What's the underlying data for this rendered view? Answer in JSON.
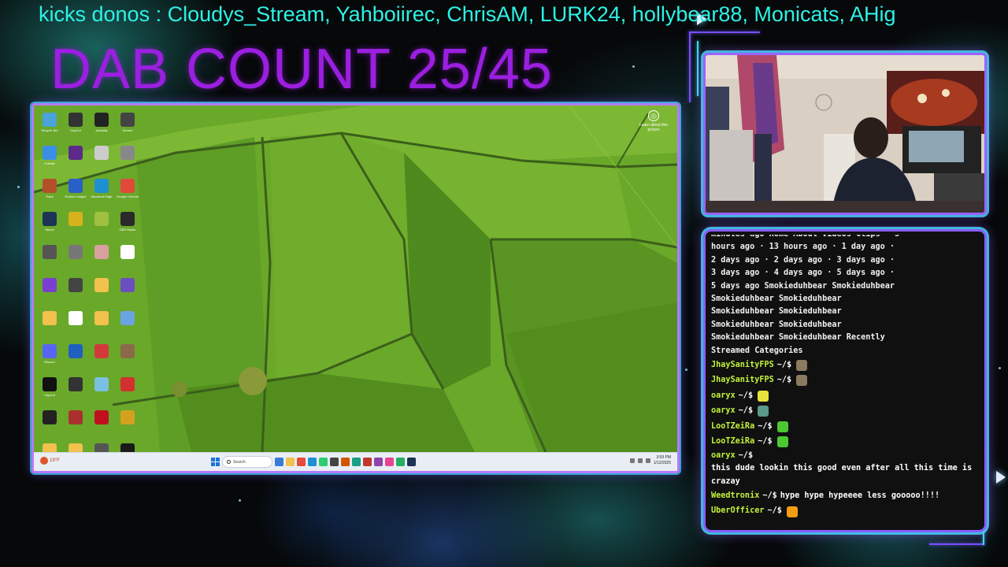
{
  "overlay": {
    "ticker": "kicks donos : Cloudys_Stream, Yahboiirec, ChrisAM, LURK24, hollybear88, Monicats, AHig",
    "dab_count": "DAB COUNT 25/45"
  },
  "desktop": {
    "icons": [
      {
        "label": "Recycle Bin",
        "icon": "recycle-bin-icon",
        "color": "#4aa3d9"
      },
      {
        "label": "CapCut",
        "icon": "obs-icon",
        "color": "#333333"
      },
      {
        "label": "Audacity",
        "icon": "app-icon",
        "color": "#222222"
      },
      {
        "label": "Drivers",
        "icon": "app-icon",
        "color": "#444444"
      },
      {
        "label": "Fortnite",
        "icon": "fortnite-icon",
        "color": "#3a8ee6"
      },
      {
        "label": "",
        "icon": "game-icon",
        "color": "#5b2a8a"
      },
      {
        "label": "",
        "icon": "app-icon",
        "color": "#cccccc"
      },
      {
        "label": "",
        "icon": "app-icon",
        "color": "#888888"
      },
      {
        "label": "Paint",
        "icon": "paint-icon",
        "color": "#b34f2a"
      },
      {
        "label": "Rocket League",
        "icon": "rocket-league-icon",
        "color": "#2a5fc9"
      },
      {
        "label": "Microsoft Edge",
        "icon": "edge-icon",
        "color": "#1e8fd1"
      },
      {
        "label": "Google Chrome",
        "icon": "chrome-icon",
        "color": "#e14a3b"
      },
      {
        "label": "Steam",
        "icon": "steam-icon",
        "color": "#1b3355"
      },
      {
        "label": "",
        "icon": "app-icon",
        "color": "#d8b21c"
      },
      {
        "label": "",
        "icon": "app-icon",
        "color": "#a0c040"
      },
      {
        "label": "OBS Studio",
        "icon": "obs-icon",
        "color": "#2a2a2a"
      },
      {
        "label": "",
        "icon": "obs-icon",
        "color": "#555555"
      },
      {
        "label": "",
        "icon": "app-icon",
        "color": "#777777"
      },
      {
        "label": "",
        "icon": "app-icon",
        "color": "#d9a0a0"
      },
      {
        "label": "",
        "icon": "app-icon",
        "color": "#ffffff"
      },
      {
        "label": "",
        "icon": "app-icon",
        "color": "#7a3fd0"
      },
      {
        "label": "",
        "icon": "obs-icon",
        "color": "#444444"
      },
      {
        "label": "",
        "icon": "folder-icon",
        "color": "#f2c14e"
      },
      {
        "label": "",
        "icon": "app-icon",
        "color": "#6b4fbf"
      },
      {
        "label": "",
        "icon": "folder-icon",
        "color": "#f2c14e"
      },
      {
        "label": "",
        "icon": "document-icon",
        "color": "#ffffff"
      },
      {
        "label": "",
        "icon": "folder-icon",
        "color": "#f2c14e"
      },
      {
        "label": "",
        "icon": "image-icon",
        "color": "#6aa4e0"
      },
      {
        "label": "Discord",
        "icon": "discord-icon",
        "color": "#5865f2"
      },
      {
        "label": "",
        "icon": "app-icon",
        "color": "#2060c0"
      },
      {
        "label": "",
        "icon": "map-pin-icon",
        "color": "#d23a3a"
      },
      {
        "label": "",
        "icon": "app-icon",
        "color": "#8a6a4a"
      },
      {
        "label": "CapCut",
        "icon": "capcut-icon",
        "color": "#111111"
      },
      {
        "label": "",
        "icon": "obs-icon",
        "color": "#333333"
      },
      {
        "label": "",
        "icon": "app-icon",
        "color": "#7ac0e0"
      },
      {
        "label": "",
        "icon": "app-icon",
        "color": "#d33030"
      },
      {
        "label": "",
        "icon": "obs-icon",
        "color": "#222222"
      },
      {
        "label": "",
        "icon": "app-icon",
        "color": "#aa3030"
      },
      {
        "label": "",
        "icon": "app-icon",
        "color": "#c01020"
      },
      {
        "label": "",
        "icon": "app-icon",
        "color": "#d4a020"
      },
      {
        "label": "",
        "icon": "folder-icon",
        "color": "#f2c14e"
      },
      {
        "label": "",
        "icon": "folder-icon",
        "color": "#f2c14e"
      },
      {
        "label": "",
        "icon": "app-icon",
        "color": "#555555"
      },
      {
        "label": "",
        "icon": "epic-games-icon",
        "color": "#1a1a1a"
      }
    ],
    "learn_label": "Learn about this picture",
    "taskbar": {
      "weather_text": "19°F",
      "search_placeholder": "Search",
      "time": "3:59 PM",
      "date": "1/12/2025",
      "apps": [
        "#3a7bd5",
        "#f2c14e",
        "#e74c3c",
        "#1e8fd1",
        "#2ecc71",
        "#444444",
        "#d35400",
        "#16a085",
        "#c0392b",
        "#8e44ad",
        "#e84393",
        "#27ae60",
        "#1b3355"
      ]
    }
  },
  "chat": {
    "header_lines": [
      "minutes ago Home About Videos Clips · 5",
      "hours ago · 13 hours ago · 1 day ago ·",
      "2 days ago · 2 days ago · 3 days ago ·",
      "3 days ago · 4 days ago · 5 days ago ·",
      "5 days ago Smokieduhbear Smokieduhbear",
      "Smokieduhbear Smokieduhbear",
      "Smokieduhbear Smokieduhbear",
      "Smokieduhbear Smokieduhbear",
      "Smokieduhbear Smokieduhbear Recently",
      "Streamed Categories"
    ],
    "messages": [
      {
        "user": "JhaySanityFPS",
        "prompt": "~/$",
        "text": "",
        "emote": "#8a7a60",
        "emote_name": "avatar-emote-icon"
      },
      {
        "user": "JhaySanityFPS",
        "prompt": "~/$",
        "text": "",
        "emote": "#8a7a60",
        "emote_name": "avatar-emote-icon"
      },
      {
        "user": "oaryx",
        "prompt": "~/$",
        "text": "",
        "emote": "#e8e23a",
        "emote_name": "w-emote-icon"
      },
      {
        "user": "oaryx",
        "prompt": "~/$",
        "text": "",
        "emote": "#5a9a8a",
        "emote_name": "face-emote-icon"
      },
      {
        "user": "LooTZeiRa",
        "prompt": "~/$",
        "text": "",
        "emote": "#4cc832",
        "emote_name": "blob-emote-icon"
      },
      {
        "user": "LooTZeiRa",
        "prompt": "~/$",
        "text": "",
        "emote": "#4cc832",
        "emote_name": "blob-emote-icon"
      },
      {
        "user": "oaryx",
        "prompt": "~/$",
        "text": "this dude lookin this good even after all this time is crazay",
        "emote": "",
        "emote_name": ""
      },
      {
        "user": "Weedtronix",
        "prompt": "~/$",
        "text": "hype hype hypeeee less gooooo!!!!",
        "emote": "",
        "emote_name": ""
      },
      {
        "user": "UberOfficer",
        "prompt": "~/$",
        "text": "",
        "emote": "#f39c12",
        "emote_name": "fire-emote-icon"
      }
    ]
  }
}
